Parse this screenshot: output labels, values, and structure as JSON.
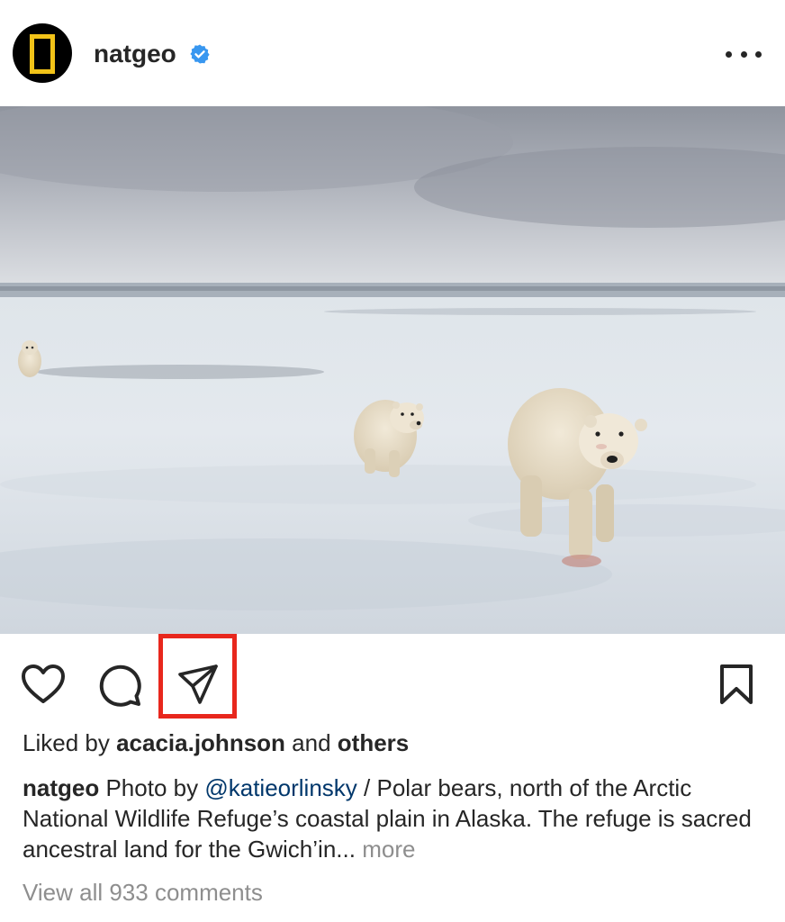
{
  "header": {
    "username": "natgeo",
    "verified": true,
    "avatar_icon": "national-geographic-logo-icon",
    "more_icon": "ellipsis-icon"
  },
  "photo": {
    "subject": "three polar bears walking on snow-covered ice under an overcast sky"
  },
  "actions": {
    "like_icon": "heart-icon",
    "comment_icon": "comment-bubble-icon",
    "share_icon": "paper-plane-icon",
    "save_icon": "bookmark-icon",
    "highlight_color": "#e8271d"
  },
  "likes": {
    "prefix": "Liked by",
    "user": "acacia.johnson",
    "middle": "and",
    "others": "others"
  },
  "caption": {
    "author": "natgeo",
    "text_before_mention": "Photo by",
    "mention": "@katieorlinsky",
    "text_after_mention": "/ Polar bears, north of the Arctic National Wildlife Refuge’s coastal plain in Alaska. The refuge is sacred ancestral land for the Gwich’in...",
    "more_label": "more"
  },
  "comments": {
    "view_all_label": "View all 933 comments"
  },
  "colors": {
    "text": "#262626",
    "muted": "#8e8e8e",
    "link": "#00376b",
    "verified": "#3897f0",
    "natgeo_yellow": "#f2c318"
  }
}
